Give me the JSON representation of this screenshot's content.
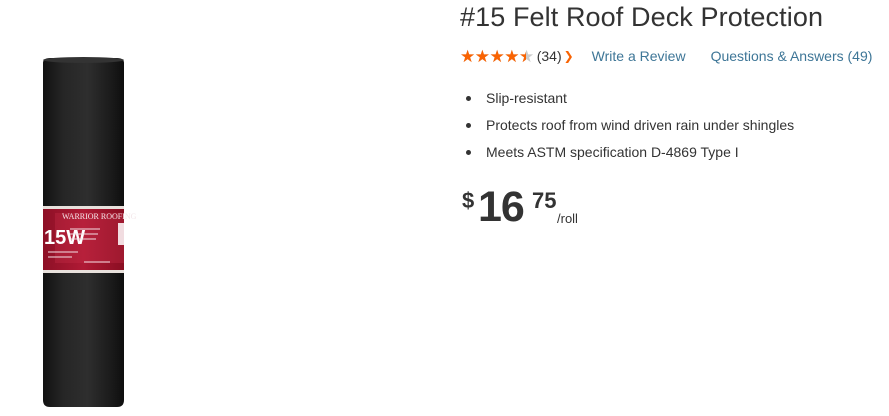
{
  "product": {
    "title": "#15 Felt Roof Deck Protection",
    "image_label": {
      "brand": "WARRIOR ROOFING",
      "grade": "15W"
    }
  },
  "rating": {
    "stars_value": 4.5,
    "stars_max": 5,
    "count": "(34)",
    "dropdown_icon": "chevron-down-icon",
    "accent_color": "#f96302"
  },
  "links": {
    "write_review": "Write a Review",
    "questions_answers": "Questions & Answers (49)",
    "link_color": "#3e7697"
  },
  "highlights": [
    "Slip-resistant",
    "Protects roof from wind driven rain under shingles",
    "Meets ASTM specification D-4869 Type I"
  ],
  "price": {
    "currency": "$",
    "dollars": "16",
    "cents": "75",
    "unit": "/roll"
  }
}
